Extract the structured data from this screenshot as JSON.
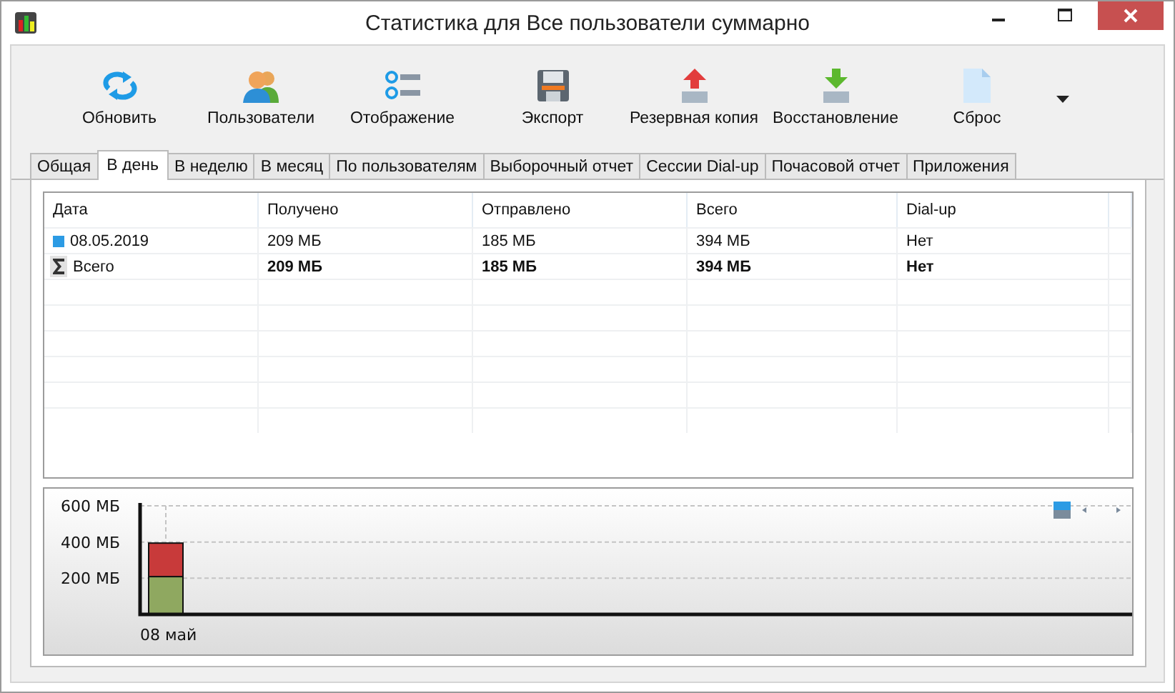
{
  "window": {
    "title": "Статистика для Все пользователи суммарно"
  },
  "toolbar": [
    {
      "label": "Обновить",
      "kind": "refresh"
    },
    {
      "label": "Пользователи",
      "kind": "users"
    },
    {
      "label": "Отображение",
      "kind": "display"
    },
    {
      "label": "Экспорт",
      "kind": "export"
    },
    {
      "label": "Резервная копия",
      "kind": "backup"
    },
    {
      "label": "Восстановление",
      "kind": "restore"
    },
    {
      "label": "Сброс",
      "kind": "reset"
    }
  ],
  "tabs": [
    {
      "label": "Общая",
      "selected": false
    },
    {
      "label": "В день",
      "selected": true
    },
    {
      "label": "В неделю",
      "selected": false
    },
    {
      "label": "В месяц",
      "selected": false
    },
    {
      "label": "По пользователям",
      "selected": false
    },
    {
      "label": "Выборочный отчет",
      "selected": false
    },
    {
      "label": "Сессии Dial-up",
      "selected": false
    },
    {
      "label": "Почасовой отчет",
      "selected": false
    },
    {
      "label": "Приложения",
      "selected": false
    }
  ],
  "table": {
    "columns": [
      "Дата",
      "Получено",
      "Отправлено",
      "Всего",
      "Dial-up"
    ],
    "rows": [
      {
        "kind": "day",
        "cells": [
          "08.05.2019",
          "209 МБ",
          "185 МБ",
          "394 МБ",
          "Нет"
        ]
      },
      {
        "kind": "total",
        "cells": [
          "Всего",
          "209 МБ",
          "185 МБ",
          "394 МБ",
          "Нет"
        ]
      }
    ]
  },
  "chart": {
    "chart_data": {
      "type": "bar",
      "stacked": true,
      "categories": [
        "08 май"
      ],
      "ylim": [
        0,
        600
      ],
      "yticks": [
        {
          "value": 200,
          "label": "200 МБ"
        },
        {
          "value": 400,
          "label": "400 МБ"
        },
        {
          "value": 600,
          "label": "600 МБ"
        }
      ],
      "grid": true,
      "series": [
        {
          "color": "#8fa860",
          "values": [
            209
          ]
        },
        {
          "color": "#c83a3a",
          "values": [
            185
          ]
        }
      ]
    }
  }
}
